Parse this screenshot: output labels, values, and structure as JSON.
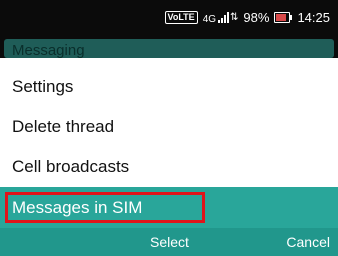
{
  "status_bar": {
    "volte": "VoLTE",
    "network": "4G",
    "battery": "98%",
    "time": "14:25"
  },
  "underlay": {
    "title": "Messaging"
  },
  "menu": {
    "items": [
      {
        "label": "Settings"
      },
      {
        "label": "Delete thread"
      },
      {
        "label": "Cell broadcasts"
      },
      {
        "label": "Messages in SIM"
      }
    ],
    "selected_index": 3
  },
  "softkeys": {
    "center": "Select",
    "right": "Cancel"
  },
  "colors": {
    "status_bar": "#0b0b0b",
    "selected_row": "#29a69a",
    "softkeys": "#21978c",
    "highlight_border": "#e0141a"
  }
}
